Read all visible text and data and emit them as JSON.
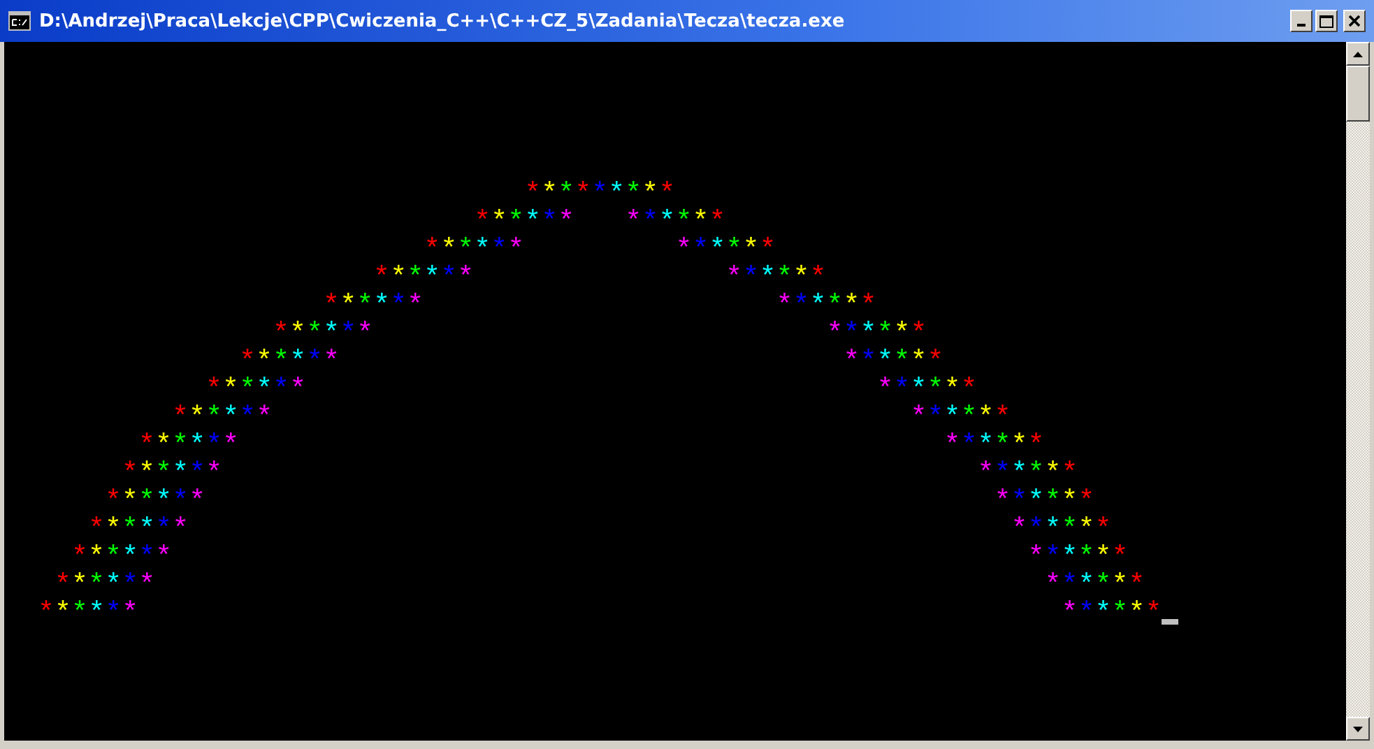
{
  "window": {
    "title": "D:\\Andrzej\\Praca\\Lekcje\\CPP\\Cwiczenia_C++\\C++CZ_5\\Zadania\\Tecza\\tecza.exe"
  },
  "console": {
    "lines": [
      {
        "cells": [
          {
            "kind": "space",
            "text": "                               "
          },
          {
            "kind": "char",
            "text": "*",
            "color": "#ff0000"
          },
          {
            "kind": "char",
            "text": "*",
            "color": "#ffff00"
          },
          {
            "kind": "char",
            "text": "*",
            "color": "#00ff00"
          },
          {
            "kind": "char",
            "text": "*",
            "color": "#ff0000"
          },
          {
            "kind": "char",
            "text": "*",
            "color": "#0000ff"
          },
          {
            "kind": "char",
            "text": "*",
            "color": "#00ffff"
          },
          {
            "kind": "char",
            "text": "*",
            "color": "#00ff00"
          },
          {
            "kind": "char",
            "text": "*",
            "color": "#ffff00"
          },
          {
            "kind": "char",
            "text": "*",
            "color": "#ff0000"
          }
        ]
      },
      {
        "cells": [
          {
            "kind": "space",
            "text": "                            "
          },
          {
            "kind": "char",
            "text": "*",
            "color": "#ff0000"
          },
          {
            "kind": "char",
            "text": "*",
            "color": "#ffff00"
          },
          {
            "kind": "char",
            "text": "*",
            "color": "#00ff00"
          },
          {
            "kind": "char",
            "text": "*",
            "color": "#00ffff"
          },
          {
            "kind": "char",
            "text": "*",
            "color": "#0000ff"
          },
          {
            "kind": "char",
            "text": "*",
            "color": "#ff00ff"
          },
          {
            "kind": "space",
            "text": "   "
          },
          {
            "kind": "char",
            "text": "*",
            "color": "#ff00ff"
          },
          {
            "kind": "char",
            "text": "*",
            "color": "#0000ff"
          },
          {
            "kind": "char",
            "text": "*",
            "color": "#00ffff"
          },
          {
            "kind": "char",
            "text": "*",
            "color": "#00ff00"
          },
          {
            "kind": "char",
            "text": "*",
            "color": "#ffff00"
          },
          {
            "kind": "char",
            "text": "*",
            "color": "#ff0000"
          }
        ]
      },
      {
        "cells": [
          {
            "kind": "space",
            "text": "                         "
          },
          {
            "kind": "char",
            "text": "*",
            "color": "#ff0000"
          },
          {
            "kind": "char",
            "text": "*",
            "color": "#ffff00"
          },
          {
            "kind": "char",
            "text": "*",
            "color": "#00ff00"
          },
          {
            "kind": "char",
            "text": "*",
            "color": "#00ffff"
          },
          {
            "kind": "char",
            "text": "*",
            "color": "#0000ff"
          },
          {
            "kind": "char",
            "text": "*",
            "color": "#ff00ff"
          },
          {
            "kind": "space",
            "text": "         "
          },
          {
            "kind": "char",
            "text": "*",
            "color": "#ff00ff"
          },
          {
            "kind": "char",
            "text": "*",
            "color": "#0000ff"
          },
          {
            "kind": "char",
            "text": "*",
            "color": "#00ffff"
          },
          {
            "kind": "char",
            "text": "*",
            "color": "#00ff00"
          },
          {
            "kind": "char",
            "text": "*",
            "color": "#ffff00"
          },
          {
            "kind": "char",
            "text": "*",
            "color": "#ff0000"
          }
        ]
      },
      {
        "cells": [
          {
            "kind": "space",
            "text": "                      "
          },
          {
            "kind": "char",
            "text": "*",
            "color": "#ff0000"
          },
          {
            "kind": "char",
            "text": "*",
            "color": "#ffff00"
          },
          {
            "kind": "char",
            "text": "*",
            "color": "#00ff00"
          },
          {
            "kind": "char",
            "text": "*",
            "color": "#00ffff"
          },
          {
            "kind": "char",
            "text": "*",
            "color": "#0000ff"
          },
          {
            "kind": "char",
            "text": "*",
            "color": "#ff00ff"
          },
          {
            "kind": "space",
            "text": "               "
          },
          {
            "kind": "char",
            "text": "*",
            "color": "#ff00ff"
          },
          {
            "kind": "char",
            "text": "*",
            "color": "#0000ff"
          },
          {
            "kind": "char",
            "text": "*",
            "color": "#00ffff"
          },
          {
            "kind": "char",
            "text": "*",
            "color": "#00ff00"
          },
          {
            "kind": "char",
            "text": "*",
            "color": "#ffff00"
          },
          {
            "kind": "char",
            "text": "*",
            "color": "#ff0000"
          }
        ]
      },
      {
        "cells": [
          {
            "kind": "space",
            "text": "                   "
          },
          {
            "kind": "char",
            "text": "*",
            "color": "#ff0000"
          },
          {
            "kind": "char",
            "text": "*",
            "color": "#ffff00"
          },
          {
            "kind": "char",
            "text": "*",
            "color": "#00ff00"
          },
          {
            "kind": "char",
            "text": "*",
            "color": "#00ffff"
          },
          {
            "kind": "char",
            "text": "*",
            "color": "#0000ff"
          },
          {
            "kind": "char",
            "text": "*",
            "color": "#ff00ff"
          },
          {
            "kind": "space",
            "text": "                     "
          },
          {
            "kind": "char",
            "text": "*",
            "color": "#ff00ff"
          },
          {
            "kind": "char",
            "text": "*",
            "color": "#0000ff"
          },
          {
            "kind": "char",
            "text": "*",
            "color": "#00ffff"
          },
          {
            "kind": "char",
            "text": "*",
            "color": "#00ff00"
          },
          {
            "kind": "char",
            "text": "*",
            "color": "#ffff00"
          },
          {
            "kind": "char",
            "text": "*",
            "color": "#ff0000"
          }
        ]
      },
      {
        "cells": [
          {
            "kind": "space",
            "text": "                "
          },
          {
            "kind": "char",
            "text": "*",
            "color": "#ff0000"
          },
          {
            "kind": "char",
            "text": "*",
            "color": "#ffff00"
          },
          {
            "kind": "char",
            "text": "*",
            "color": "#00ff00"
          },
          {
            "kind": "char",
            "text": "*",
            "color": "#00ffff"
          },
          {
            "kind": "char",
            "text": "*",
            "color": "#0000ff"
          },
          {
            "kind": "char",
            "text": "*",
            "color": "#ff00ff"
          },
          {
            "kind": "space",
            "text": "                           "
          },
          {
            "kind": "char",
            "text": "*",
            "color": "#ff00ff"
          },
          {
            "kind": "char",
            "text": "*",
            "color": "#0000ff"
          },
          {
            "kind": "char",
            "text": "*",
            "color": "#00ffff"
          },
          {
            "kind": "char",
            "text": "*",
            "color": "#00ff00"
          },
          {
            "kind": "char",
            "text": "*",
            "color": "#ffff00"
          },
          {
            "kind": "char",
            "text": "*",
            "color": "#ff0000"
          }
        ]
      },
      {
        "cells": [
          {
            "kind": "space",
            "text": "              "
          },
          {
            "kind": "char",
            "text": "*",
            "color": "#ff0000"
          },
          {
            "kind": "char",
            "text": "*",
            "color": "#ffff00"
          },
          {
            "kind": "char",
            "text": "*",
            "color": "#00ff00"
          },
          {
            "kind": "char",
            "text": "*",
            "color": "#00ffff"
          },
          {
            "kind": "char",
            "text": "*",
            "color": "#0000ff"
          },
          {
            "kind": "char",
            "text": "*",
            "color": "#ff00ff"
          },
          {
            "kind": "space",
            "text": "                              "
          },
          {
            "kind": "char",
            "text": "*",
            "color": "#ff00ff"
          },
          {
            "kind": "char",
            "text": "*",
            "color": "#0000ff"
          },
          {
            "kind": "char",
            "text": "*",
            "color": "#00ffff"
          },
          {
            "kind": "char",
            "text": "*",
            "color": "#00ff00"
          },
          {
            "kind": "char",
            "text": "*",
            "color": "#ffff00"
          },
          {
            "kind": "char",
            "text": "*",
            "color": "#ff0000"
          }
        ]
      },
      {
        "cells": [
          {
            "kind": "space",
            "text": "            "
          },
          {
            "kind": "char",
            "text": "*",
            "color": "#ff0000"
          },
          {
            "kind": "char",
            "text": "*",
            "color": "#ffff00"
          },
          {
            "kind": "char",
            "text": "*",
            "color": "#00ff00"
          },
          {
            "kind": "char",
            "text": "*",
            "color": "#00ffff"
          },
          {
            "kind": "char",
            "text": "*",
            "color": "#0000ff"
          },
          {
            "kind": "char",
            "text": "*",
            "color": "#ff00ff"
          },
          {
            "kind": "space",
            "text": "                                  "
          },
          {
            "kind": "char",
            "text": "*",
            "color": "#ff00ff"
          },
          {
            "kind": "char",
            "text": "*",
            "color": "#0000ff"
          },
          {
            "kind": "char",
            "text": "*",
            "color": "#00ffff"
          },
          {
            "kind": "char",
            "text": "*",
            "color": "#00ff00"
          },
          {
            "kind": "char",
            "text": "*",
            "color": "#ffff00"
          },
          {
            "kind": "char",
            "text": "*",
            "color": "#ff0000"
          }
        ]
      },
      {
        "cells": [
          {
            "kind": "space",
            "text": "          "
          },
          {
            "kind": "char",
            "text": "*",
            "color": "#ff0000"
          },
          {
            "kind": "char",
            "text": "*",
            "color": "#ffff00"
          },
          {
            "kind": "char",
            "text": "*",
            "color": "#00ff00"
          },
          {
            "kind": "char",
            "text": "*",
            "color": "#00ffff"
          },
          {
            "kind": "char",
            "text": "*",
            "color": "#0000ff"
          },
          {
            "kind": "char",
            "text": "*",
            "color": "#ff00ff"
          },
          {
            "kind": "space",
            "text": "                                      "
          },
          {
            "kind": "char",
            "text": "*",
            "color": "#ff00ff"
          },
          {
            "kind": "char",
            "text": "*",
            "color": "#0000ff"
          },
          {
            "kind": "char",
            "text": "*",
            "color": "#00ffff"
          },
          {
            "kind": "char",
            "text": "*",
            "color": "#00ff00"
          },
          {
            "kind": "char",
            "text": "*",
            "color": "#ffff00"
          },
          {
            "kind": "char",
            "text": "*",
            "color": "#ff0000"
          }
        ]
      },
      {
        "cells": [
          {
            "kind": "space",
            "text": "        "
          },
          {
            "kind": "char",
            "text": "*",
            "color": "#ff0000"
          },
          {
            "kind": "char",
            "text": "*",
            "color": "#ffff00"
          },
          {
            "kind": "char",
            "text": "*",
            "color": "#00ff00"
          },
          {
            "kind": "char",
            "text": "*",
            "color": "#00ffff"
          },
          {
            "kind": "char",
            "text": "*",
            "color": "#0000ff"
          },
          {
            "kind": "char",
            "text": "*",
            "color": "#ff00ff"
          },
          {
            "kind": "space",
            "text": "                                          "
          },
          {
            "kind": "char",
            "text": "*",
            "color": "#ff00ff"
          },
          {
            "kind": "char",
            "text": "*",
            "color": "#0000ff"
          },
          {
            "kind": "char",
            "text": "*",
            "color": "#00ffff"
          },
          {
            "kind": "char",
            "text": "*",
            "color": "#00ff00"
          },
          {
            "kind": "char",
            "text": "*",
            "color": "#ffff00"
          },
          {
            "kind": "char",
            "text": "*",
            "color": "#ff0000"
          }
        ]
      },
      {
        "cells": [
          {
            "kind": "space",
            "text": "       "
          },
          {
            "kind": "char",
            "text": "*",
            "color": "#ff0000"
          },
          {
            "kind": "char",
            "text": "*",
            "color": "#ffff00"
          },
          {
            "kind": "char",
            "text": "*",
            "color": "#00ff00"
          },
          {
            "kind": "char",
            "text": "*",
            "color": "#00ffff"
          },
          {
            "kind": "char",
            "text": "*",
            "color": "#0000ff"
          },
          {
            "kind": "char",
            "text": "*",
            "color": "#ff00ff"
          },
          {
            "kind": "space",
            "text": "                                             "
          },
          {
            "kind": "char",
            "text": "*",
            "color": "#ff00ff"
          },
          {
            "kind": "char",
            "text": "*",
            "color": "#0000ff"
          },
          {
            "kind": "char",
            "text": "*",
            "color": "#00ffff"
          },
          {
            "kind": "char",
            "text": "*",
            "color": "#00ff00"
          },
          {
            "kind": "char",
            "text": "*",
            "color": "#ffff00"
          },
          {
            "kind": "char",
            "text": "*",
            "color": "#ff0000"
          }
        ]
      },
      {
        "cells": [
          {
            "kind": "space",
            "text": "      "
          },
          {
            "kind": "char",
            "text": "*",
            "color": "#ff0000"
          },
          {
            "kind": "char",
            "text": "*",
            "color": "#ffff00"
          },
          {
            "kind": "char",
            "text": "*",
            "color": "#00ff00"
          },
          {
            "kind": "char",
            "text": "*",
            "color": "#00ffff"
          },
          {
            "kind": "char",
            "text": "*",
            "color": "#0000ff"
          },
          {
            "kind": "char",
            "text": "*",
            "color": "#ff00ff"
          },
          {
            "kind": "space",
            "text": "                                               "
          },
          {
            "kind": "char",
            "text": "*",
            "color": "#ff00ff"
          },
          {
            "kind": "char",
            "text": "*",
            "color": "#0000ff"
          },
          {
            "kind": "char",
            "text": "*",
            "color": "#00ffff"
          },
          {
            "kind": "char",
            "text": "*",
            "color": "#00ff00"
          },
          {
            "kind": "char",
            "text": "*",
            "color": "#ffff00"
          },
          {
            "kind": "char",
            "text": "*",
            "color": "#ff0000"
          }
        ]
      },
      {
        "cells": [
          {
            "kind": "space",
            "text": "     "
          },
          {
            "kind": "char",
            "text": "*",
            "color": "#ff0000"
          },
          {
            "kind": "char",
            "text": "*",
            "color": "#ffff00"
          },
          {
            "kind": "char",
            "text": "*",
            "color": "#00ff00"
          },
          {
            "kind": "char",
            "text": "*",
            "color": "#00ffff"
          },
          {
            "kind": "char",
            "text": "*",
            "color": "#0000ff"
          },
          {
            "kind": "char",
            "text": "*",
            "color": "#ff00ff"
          },
          {
            "kind": "space",
            "text": "                                                 "
          },
          {
            "kind": "char",
            "text": "*",
            "color": "#ff00ff"
          },
          {
            "kind": "char",
            "text": "*",
            "color": "#0000ff"
          },
          {
            "kind": "char",
            "text": "*",
            "color": "#00ffff"
          },
          {
            "kind": "char",
            "text": "*",
            "color": "#00ff00"
          },
          {
            "kind": "char",
            "text": "*",
            "color": "#ffff00"
          },
          {
            "kind": "char",
            "text": "*",
            "color": "#ff0000"
          }
        ]
      },
      {
        "cells": [
          {
            "kind": "space",
            "text": "    "
          },
          {
            "kind": "char",
            "text": "*",
            "color": "#ff0000"
          },
          {
            "kind": "char",
            "text": "*",
            "color": "#ffff00"
          },
          {
            "kind": "char",
            "text": "*",
            "color": "#00ff00"
          },
          {
            "kind": "char",
            "text": "*",
            "color": "#00ffff"
          },
          {
            "kind": "char",
            "text": "*",
            "color": "#0000ff"
          },
          {
            "kind": "char",
            "text": "*",
            "color": "#ff00ff"
          },
          {
            "kind": "space",
            "text": "                                                   "
          },
          {
            "kind": "char",
            "text": "*",
            "color": "#ff00ff"
          },
          {
            "kind": "char",
            "text": "*",
            "color": "#0000ff"
          },
          {
            "kind": "char",
            "text": "*",
            "color": "#00ffff"
          },
          {
            "kind": "char",
            "text": "*",
            "color": "#00ff00"
          },
          {
            "kind": "char",
            "text": "*",
            "color": "#ffff00"
          },
          {
            "kind": "char",
            "text": "*",
            "color": "#ff0000"
          }
        ]
      },
      {
        "cells": [
          {
            "kind": "space",
            "text": "   "
          },
          {
            "kind": "char",
            "text": "*",
            "color": "#ff0000"
          },
          {
            "kind": "char",
            "text": "*",
            "color": "#ffff00"
          },
          {
            "kind": "char",
            "text": "*",
            "color": "#00ff00"
          },
          {
            "kind": "char",
            "text": "*",
            "color": "#00ffff"
          },
          {
            "kind": "char",
            "text": "*",
            "color": "#0000ff"
          },
          {
            "kind": "char",
            "text": "*",
            "color": "#ff00ff"
          },
          {
            "kind": "space",
            "text": "                                                     "
          },
          {
            "kind": "char",
            "text": "*",
            "color": "#ff00ff"
          },
          {
            "kind": "char",
            "text": "*",
            "color": "#0000ff"
          },
          {
            "kind": "char",
            "text": "*",
            "color": "#00ffff"
          },
          {
            "kind": "char",
            "text": "*",
            "color": "#00ff00"
          },
          {
            "kind": "char",
            "text": "*",
            "color": "#ffff00"
          },
          {
            "kind": "char",
            "text": "*",
            "color": "#ff0000"
          }
        ]
      },
      {
        "cells": [
          {
            "kind": "space",
            "text": "  "
          },
          {
            "kind": "char",
            "text": "*",
            "color": "#ff0000"
          },
          {
            "kind": "char",
            "text": "*",
            "color": "#ffff00"
          },
          {
            "kind": "char",
            "text": "*",
            "color": "#00ff00"
          },
          {
            "kind": "char",
            "text": "*",
            "color": "#00ffff"
          },
          {
            "kind": "char",
            "text": "*",
            "color": "#0000ff"
          },
          {
            "kind": "char",
            "text": "*",
            "color": "#ff00ff"
          },
          {
            "kind": "space",
            "text": "                                                       "
          },
          {
            "kind": "char",
            "text": "*",
            "color": "#ff00ff"
          },
          {
            "kind": "char",
            "text": "*",
            "color": "#0000ff"
          },
          {
            "kind": "char",
            "text": "*",
            "color": "#00ffff"
          },
          {
            "kind": "char",
            "text": "*",
            "color": "#00ff00"
          },
          {
            "kind": "char",
            "text": "*",
            "color": "#ffff00"
          },
          {
            "kind": "char",
            "text": "*",
            "color": "#ff0000"
          }
        ]
      }
    ]
  }
}
